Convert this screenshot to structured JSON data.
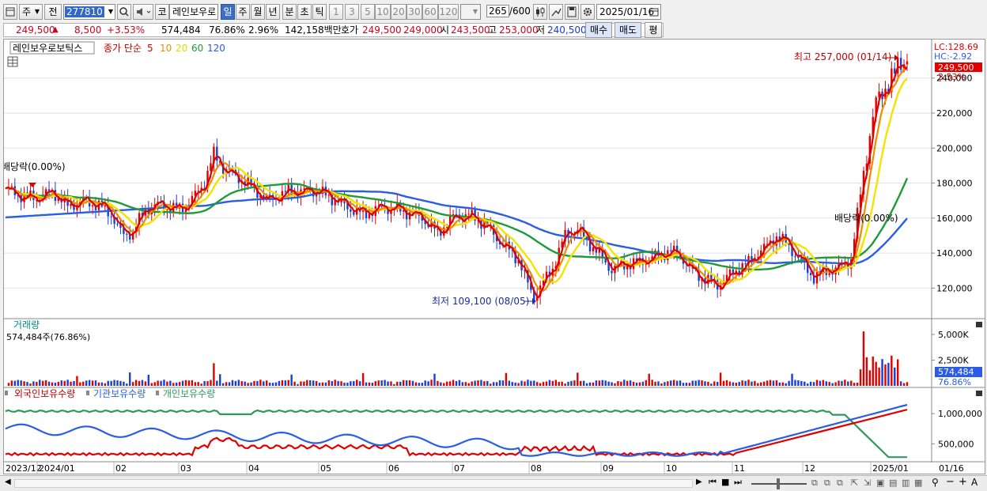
{
  "toolbar": {
    "period_label": "주",
    "prev_label": "전",
    "code": "277810",
    "kr_label": "코",
    "stock_name": "레인보우로",
    "tabs": [
      "일",
      "주",
      "월",
      "년",
      "분",
      "초",
      "틱"
    ],
    "num_tabs": [
      "1",
      "3",
      "5",
      "10",
      "20",
      "30",
      "60",
      "120"
    ],
    "count_value": "265",
    "count_total": "/600",
    "date": "2025/01/16"
  },
  "quote": {
    "price": "249,500",
    "up_arrow": "▲",
    "change": "8,500",
    "change_pct": "+3.53%",
    "volume": "574,484",
    "vol_ratio": "76.86%",
    "turnover_pct": "2.96%",
    "amount": "142,158백만",
    "hoga_label": "호가",
    "ask": "249,500",
    "bid": "249,000",
    "open_label": "시",
    "open": "243,500",
    "high_label": "고",
    "high": "253,000",
    "low_label": "저",
    "low": "240,500",
    "buy_label": "매수",
    "sell_label": "매도",
    "flat_label": "평"
  },
  "legend": {
    "name": "레인보우로보틱스",
    "ma_title": "종가 단순",
    "ma5": "5",
    "ma10": "10",
    "ma20": "20",
    "ma60": "60",
    "ma120": "120",
    "lc": "LC:128.69",
    "hc": "HC:-2.92",
    "price_tag": "249,500",
    "pct_tag": "3.53%"
  },
  "annotations": {
    "high": "최고 257,000 (01/14)",
    "low": "최저 109,100 (08/05)",
    "div1": "배당락(0.00%)",
    "div2": "배당락(0.00%)"
  },
  "volume_panel": {
    "title": "거래량",
    "sub": "574,484주(76.86%)",
    "tag_value": "574,484",
    "tag_pct": "76.86%"
  },
  "holdings_panel": {
    "foreign": "외국인보유수량",
    "inst": "기관보유수량",
    "indiv": "개인보유수량"
  },
  "chart_data": {
    "type": "line",
    "price_axis": {
      "ticks": [
        "240,000",
        "220,000",
        "200,000",
        "180,000",
        "160,000",
        "140,000",
        "120,000"
      ],
      "range": [
        103000,
        262000
      ]
    },
    "volume_axis": {
      "ticks": [
        "5,000K",
        "2,500K"
      ]
    },
    "holdings_axis": {
      "ticks": [
        "1,000,000",
        "500,000"
      ]
    },
    "x_labels": [
      "2023/12",
      "2024/01",
      "02",
      "03",
      "04",
      "05",
      "06",
      "07",
      "08",
      "09",
      "10",
      "11",
      "12",
      "2025/01",
      "01/16"
    ],
    "close_series_anchor": [
      [
        0,
        176000
      ],
      [
        10,
        172000
      ],
      [
        20,
        171000
      ],
      [
        30,
        175000
      ],
      [
        40,
        167000
      ],
      [
        50,
        170000
      ],
      [
        60,
        168000
      ],
      [
        68,
        163000
      ],
      [
        75,
        151000
      ],
      [
        82,
        153000
      ],
      [
        90,
        166000
      ],
      [
        100,
        168000
      ],
      [
        110,
        165000
      ],
      [
        118,
        168000
      ],
      [
        128,
        180000
      ],
      [
        134,
        196000
      ],
      [
        140,
        188000
      ],
      [
        150,
        182000
      ],
      [
        160,
        176000
      ],
      [
        168,
        170000
      ],
      [
        175,
        172000
      ],
      [
        182,
        175000
      ],
      [
        190,
        175000
      ],
      [
        200,
        176000
      ],
      [
        210,
        172000
      ],
      [
        220,
        167000
      ],
      [
        230,
        163000
      ],
      [
        240,
        166000
      ],
      [
        250,
        166000
      ],
      [
        260,
        163000
      ],
      [
        268,
        160000
      ],
      [
        278,
        151000
      ],
      [
        288,
        160000
      ],
      [
        298,
        161000
      ],
      [
        308,
        156000
      ],
      [
        318,
        146000
      ],
      [
        330,
        136000
      ],
      [
        336,
        122000
      ],
      [
        340,
        115000
      ],
      [
        345,
        122000
      ],
      [
        352,
        132000
      ],
      [
        360,
        151000
      ],
      [
        368,
        154000
      ],
      [
        376,
        146000
      ],
      [
        384,
        138000
      ],
      [
        390,
        131000
      ],
      [
        398,
        134000
      ],
      [
        408,
        135000
      ],
      [
        418,
        138000
      ],
      [
        428,
        141000
      ],
      [
        436,
        136000
      ],
      [
        442,
        129000
      ],
      [
        450,
        124000
      ],
      [
        458,
        121000
      ],
      [
        465,
        126000
      ],
      [
        472,
        131000
      ],
      [
        478,
        134000
      ],
      [
        484,
        140000
      ],
      [
        490,
        144000
      ],
      [
        496,
        150000
      ],
      [
        502,
        146000
      ],
      [
        508,
        140000
      ],
      [
        514,
        133000
      ],
      [
        520,
        127000
      ],
      [
        526,
        130000
      ],
      [
        532,
        131000
      ],
      [
        538,
        133000
      ],
      [
        544,
        137000
      ],
      [
        550,
        175000
      ],
      [
        555,
        205000
      ],
      [
        560,
        225000
      ],
      [
        566,
        236000
      ],
      [
        572,
        241000
      ],
      [
        576,
        249500
      ]
    ],
    "ma_colors": {
      "ma5": "#e00000",
      "ma10": "#f08c00",
      "ma20": "#f2e400",
      "ma60": "#1f9a3a",
      "ma120": "#2a5ce6"
    },
    "holdings_series": {
      "foreign": {
        "color": "#2e9a5a"
      },
      "inst": {
        "color": "#e00000"
      },
      "indiv": {
        "color": "#2a5ce6"
      }
    }
  }
}
